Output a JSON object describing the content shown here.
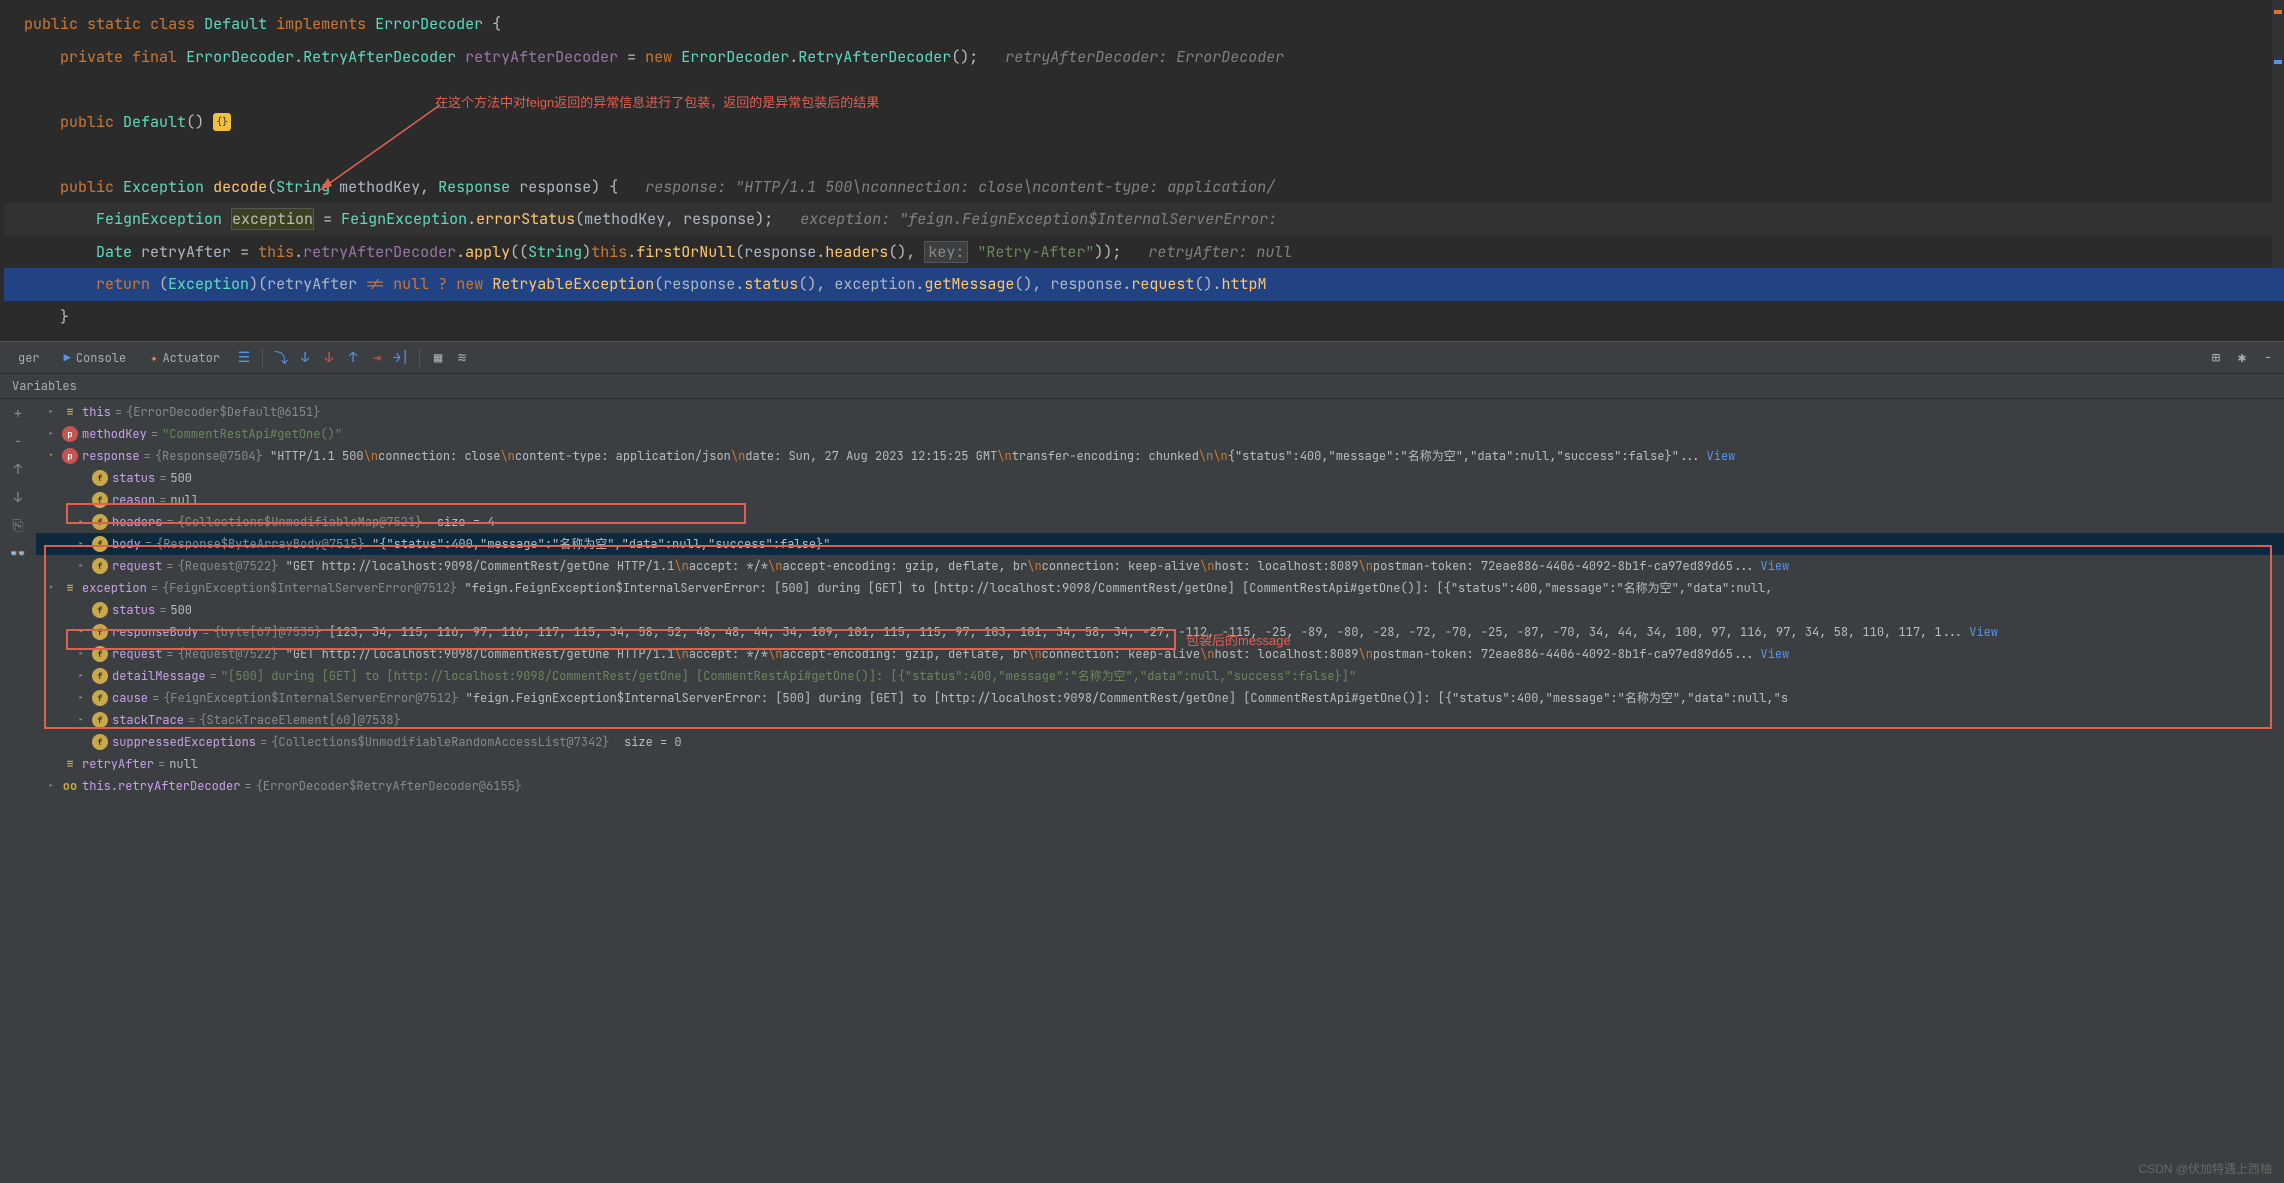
{
  "editor": {
    "annotation1": "在这个方法中对feign返回的异常信息进行了包装，返回的是异常包装后的结果",
    "annotation2": "包装后的message",
    "tokens": {
      "public": "public",
      "static": "static",
      "class": "class",
      "Default": "Default",
      "implements": "implements",
      "ErrorDecoder": "ErrorDecoder",
      "private": "private",
      "final": "final",
      "RetryAfterDecoder": "RetryAfterDecoder",
      "retryAfterDecoder": "retryAfterDecoder",
      "new": "new",
      "retryAfterDecoderHint": "retryAfterDecoder: ErrorDecoder",
      "Exception": "Exception",
      "decode": "decode",
      "String": "String",
      "methodKey": "methodKey",
      "Response": "Response",
      "response": "response",
      "responseHint": "response: \"HTTP/1.1 500\\nconnection: close\\ncontent-type: application/",
      "FeignException": "FeignException",
      "exception": "exception",
      "errorStatus": "errorStatus",
      "exceptionHint": "exception: \"feign.FeignException$InternalServerError:",
      "Date": "Date",
      "retryAfter": "retryAfter",
      "this": "this",
      "apply": "apply",
      "firstOrNull": "firstOrNull",
      "headers": "headers",
      "key": "key:",
      "retryAfterStr": "\"Retry-After\"",
      "retryAfterHint": "retryAfter: null",
      "return": "return",
      "null": "null",
      "RetryableException": "RetryableException",
      "status": "status",
      "getMessage": "getMessage",
      "request": "request",
      "httpM": "httpM"
    }
  },
  "debug": {
    "toolbar": {
      "debuggerTab": "ger",
      "consoleTab": "Console",
      "actuatorTab": "Actuator"
    },
    "variablesLabel": "Variables",
    "vars": {
      "this": {
        "name": "this",
        "type": "{ErrorDecoder$Default@6151}"
      },
      "methodKey": {
        "name": "methodKey",
        "val": "\"CommentRestApi#getOne()\""
      },
      "response": {
        "name": "response",
        "type": "{Response@7504}",
        "val": "\"HTTP/1.1 500\\nconnection: close\\ncontent-type: application/json\\ndate: Sun, 27 Aug 2023 12:15:25 GMT\\ntransfer-encoding: chunked\\n\\n{\"status\":400,\"message\":\"名称为空\",\"data\":null,\"success\":false}\""
      },
      "status": {
        "name": "status",
        "val": "500"
      },
      "reason": {
        "name": "reason",
        "val": "null"
      },
      "headersVar": {
        "name": "headers",
        "type": "{Collections$UnmodifiableMap@7521}",
        "size": "size = 4"
      },
      "body": {
        "name": "body",
        "type": "{Response$ByteArrayBody@7515}",
        "val": "\"{\"status\":400,\"message\":\"名称为空\",\"data\":null,\"success\":false}\""
      },
      "requestVar": {
        "name": "request",
        "type": "{Request@7522}",
        "val": "\"GET http://localhost:9098/CommentRest/getOne HTTP/1.1\\naccept: */*\\naccept-encoding: gzip, deflate, br\\nconnection: keep-alive\\nhost: localhost:8089\\npostman-token: 72eae886-4406-4092-8b1f-ca97ed89d65"
      },
      "exceptionVar": {
        "name": "exception",
        "type": "{FeignException$InternalServerError@7512}",
        "val": "\"feign.FeignException$InternalServerError: [500] during [GET] to [http://localhost:9098/CommentRest/getOne] [CommentRestApi#getOne()]: [{\"status\":400,\"message\":\"名称为空\",\"data\":null,"
      },
      "status2": {
        "name": "status",
        "val": "500"
      },
      "responseBody": {
        "name": "responseBody",
        "type": "{byte[67]@7535}",
        "val": "[123, 34, 115, 116, 97, 116, 117, 115, 34, 58, 52, 48, 48, 44, 34, 109, 101, 115, 115, 97, 103, 101, 34, 58, 34, -27, -112, -115, -25, -89, -80, -28, -72, -70, -25, -87, -70, 34, 44, 34, 100, 97, 116, 97, 34, 58, 110, 117, 1..."
      },
      "request2": {
        "name": "request",
        "type": "{Request@7522}",
        "val": "\"GET http://localhost:9098/CommentRest/getOne HTTP/1.1\\naccept: */*\\naccept-encoding: gzip, deflate, br\\nconnection: keep-alive\\nhost: localhost:8089\\npostman-token: 72eae886-4406-4092-8b1f-ca97ed89d65"
      },
      "detailMessage": {
        "name": "detailMessage",
        "val": "\"[500] during [GET] to [http://localhost:9098/CommentRest/getOne] [CommentRestApi#getOne()]: [{\"status\":400,\"message\":\"名称为空\",\"data\":null,\"success\":false}]\""
      },
      "cause": {
        "name": "cause",
        "type": "{FeignException$InternalServerError@7512}",
        "val": "\"feign.FeignException$InternalServerError: [500] during [GET] to [http://localhost:9098/CommentRest/getOne] [CommentRestApi#getOne()]: [{\"status\":400,\"message\":\"名称为空\",\"data\":null,\"s"
      },
      "stackTrace": {
        "name": "stackTrace",
        "type": "{StackTraceElement[60]@7538}"
      },
      "suppressedExceptions": {
        "name": "suppressedExceptions",
        "type": "{Collections$UnmodifiableRandomAccessList@7342}",
        "size": "size = 0"
      },
      "retryAfter": {
        "name": "retryAfter",
        "val": "null"
      },
      "thisRetry": {
        "name": "this.retryAfterDecoder",
        "type": "{ErrorDecoder$RetryAfterDecoder@6155}"
      }
    },
    "viewLabel": "View"
  },
  "watermark": "CSDN @伏加特遇上西柚"
}
